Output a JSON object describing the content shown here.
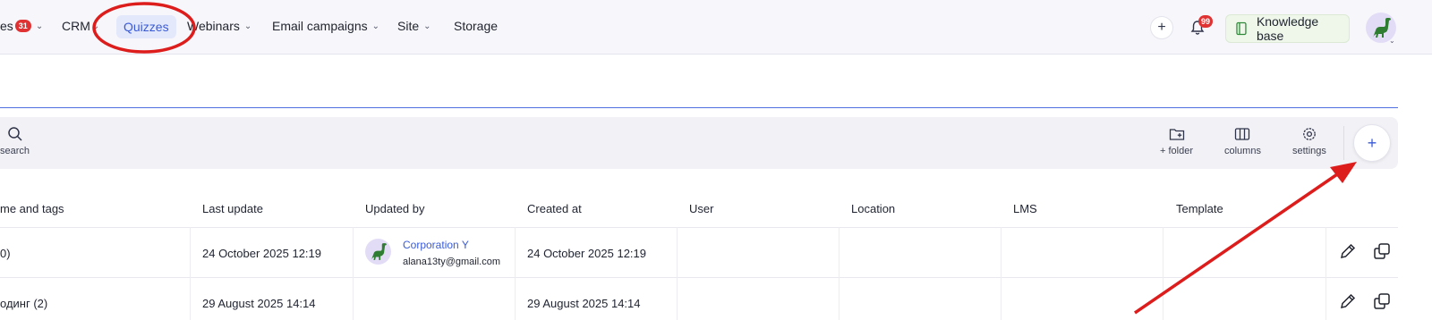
{
  "nav": {
    "items": [
      {
        "label": "es",
        "badge": "31",
        "chevron": "⌄"
      },
      {
        "label": "CRM",
        "chevron": "⌄"
      },
      {
        "label": "Quizzes",
        "active": true
      },
      {
        "label": "Webinars",
        "chevron": "⌄"
      },
      {
        "label": "Email campaigns",
        "chevron": "⌄"
      },
      {
        "label": "Site",
        "chevron": "⌄"
      },
      {
        "label": "Storage"
      }
    ],
    "notification_count": "99",
    "knowledge_base_label": "Knowledge base",
    "icons": [
      "plus-icon",
      "bell-icon",
      "book-icon",
      "dinosaur-avatar-icon"
    ]
  },
  "toolbar": {
    "search_label": "search",
    "folder_label": "+ folder",
    "columns_label": "columns",
    "settings_label": "settings",
    "add_label": "+"
  },
  "table": {
    "columns": [
      "me and tags",
      "Last update",
      "Updated by",
      "Created at",
      "User",
      "Location",
      "LMS",
      "Template"
    ],
    "rows": [
      {
        "name": "0)",
        "last_update": "24 October 2025 12:19",
        "updated_by_name": "Corporation Y",
        "updated_by_email": "alana13ty@gmail.com",
        "created_at": "24 October 2025 12:19"
      },
      {
        "name": "одинг (2)",
        "last_update": "29 August 2025 14:14",
        "updated_by_name": "",
        "updated_by_email": "",
        "created_at": "29 August 2025 14:14"
      }
    ]
  },
  "colors": {
    "accent": "#3a5bd9",
    "badge": "#e03232",
    "annotation": "#dd1c1c",
    "active_tab_bg": "#e3e8fb",
    "knowledge_base_bg": "#eef7ea"
  }
}
